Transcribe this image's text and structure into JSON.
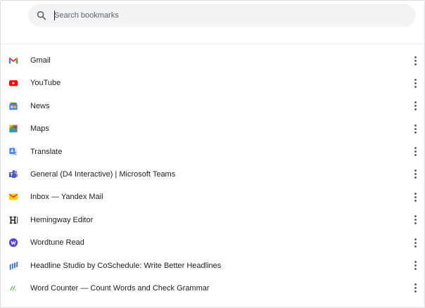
{
  "search": {
    "placeholder": "Search bookmarks",
    "value": ""
  },
  "bookmarks": [
    {
      "label": "Gmail",
      "icon": "gmail-icon"
    },
    {
      "label": "YouTube",
      "icon": "youtube-icon"
    },
    {
      "label": "News",
      "icon": "news-icon"
    },
    {
      "label": "Maps",
      "icon": "maps-icon"
    },
    {
      "label": "Translate",
      "icon": "translate-icon"
    },
    {
      "label": "General (D4 Interactive) | Microsoft Teams",
      "icon": "teams-icon"
    },
    {
      "label": "Inbox — Yandex Mail",
      "icon": "yandex-mail-icon"
    },
    {
      "label": "Hemingway Editor",
      "icon": "hemingway-icon"
    },
    {
      "label": "Wordtune Read",
      "icon": "wordtune-icon"
    },
    {
      "label": "Headline Studio by CoSchedule: Write Better Headlines",
      "icon": "headline-studio-icon"
    },
    {
      "label": "Word Counter — Count Words and Check Grammar",
      "icon": "word-counter-icon"
    }
  ],
  "colors": {
    "search_bg": "#f1f3f4",
    "text": "#202124",
    "muted": "#5f6368"
  }
}
